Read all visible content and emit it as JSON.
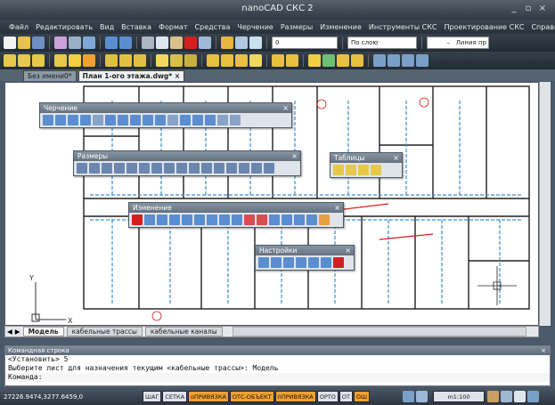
{
  "app": {
    "title": "nanoCAD СКС 2",
    "minimize": "_",
    "restore": "▫",
    "close": "×"
  },
  "menu": [
    "Файл",
    "Редактировать",
    "Вид",
    "Вставка",
    "Формат",
    "Средства",
    "Черчение",
    "Размеры",
    "Изменение",
    "Инструменты СКС",
    "Проектирование СКС",
    "Справка"
  ],
  "toolbar": {
    "layer_value": "0",
    "linetype_value": "По слою",
    "lineweight_value": "Линия пр",
    "lineweight_sep": "–"
  },
  "doc_tabs": [
    {
      "label": "Без имени0*"
    },
    {
      "label": "План 1-ого этажа.dwg*"
    }
  ],
  "tab_close": "×",
  "float_toolbars": {
    "drawing": "Черчение",
    "dimensions": "Размеры",
    "tables": "Таблицы",
    "modify": "Изменение",
    "settings": "Настройки",
    "close": "×"
  },
  "layout_tabs": [
    "Модель",
    "кабельные трассы",
    "кабельные каналы"
  ],
  "ucs": {
    "x": "X",
    "y": "Y"
  },
  "command": {
    "header": "Командная строка",
    "close": "×",
    "lines": [
      "<Установить> 5",
      "Выберите лист для назначения текущим <кабельные трассы>: Модель",
      "Команда:"
    ]
  },
  "status": {
    "coords": "27226.9474,3277.6459,0",
    "buttons": [
      {
        "label": "ШАГ",
        "on": false
      },
      {
        "label": "СЕТКА",
        "on": false
      },
      {
        "label": "оПРИВЯЗКА",
        "on": true
      },
      {
        "label": "ОТС-ОБЪЕКТ",
        "on": true
      },
      {
        "label": "пПРИВЯЗКА",
        "on": true
      },
      {
        "label": "ОРТО",
        "on": false
      },
      {
        "label": "ОТ",
        "on": false
      },
      {
        "label": "ОШ",
        "on": true
      }
    ],
    "scale": "m1:100"
  },
  "colors": {
    "accent": "#f0a030",
    "cable": "#3a8fd0",
    "wall": "#202020",
    "marker": "#d42020"
  }
}
